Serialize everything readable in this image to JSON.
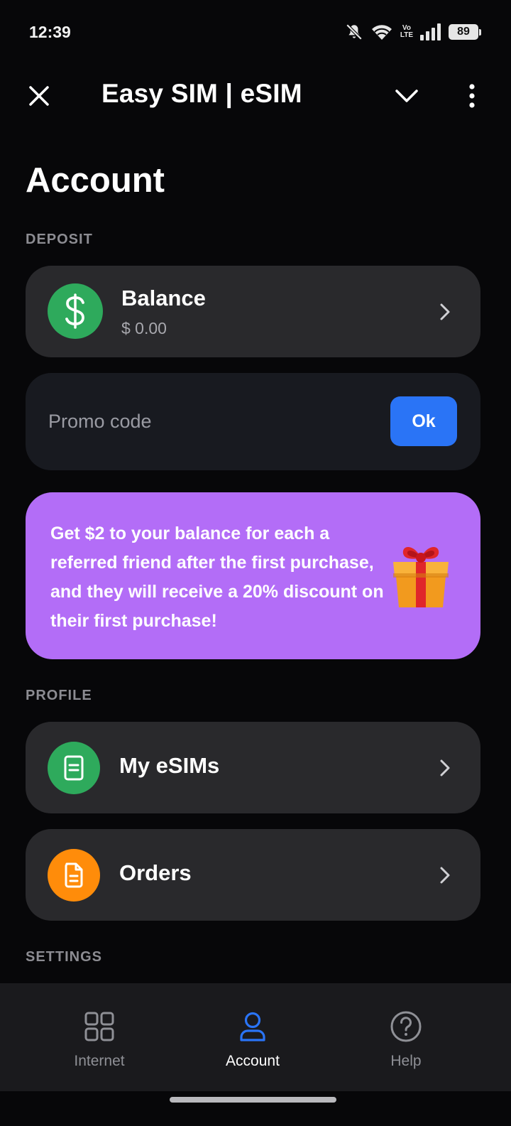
{
  "status_bar": {
    "time": "12:39",
    "battery": "89",
    "network_badge": "Vo LTE",
    "icons": [
      "bell-off-icon",
      "wifi-icon",
      "volte-icon",
      "signal-icon",
      "battery-icon"
    ]
  },
  "app_bar": {
    "title": "Easy SIM | eSIM",
    "close_icon": "close-icon",
    "chevron_icon": "chevron-down-icon",
    "menu_icon": "more-vert-icon"
  },
  "page": {
    "title": "Account"
  },
  "deposit": {
    "section_label": "DEPOSIT",
    "balance": {
      "title": "Balance",
      "amount": "$ 0.00",
      "icon": "dollar-icon",
      "icon_color": "#2eaa5c"
    },
    "promo": {
      "placeholder": "Promo code",
      "value": "",
      "button_label": "Ok",
      "button_color": "#2a74f6"
    },
    "referral": {
      "text": "Get $2 to your balance for each a referred friend after the first purchase, and they will receive a 20% discount on their first purchase!",
      "icon": "gift-icon",
      "background": "#b36df7"
    }
  },
  "profile": {
    "section_label": "PROFILE",
    "items": [
      {
        "label": "My eSIMs",
        "icon": "sim-card-icon",
        "icon_color": "#2eaa5c"
      },
      {
        "label": "Orders",
        "icon": "document-icon",
        "icon_color": "#ff8c0a"
      }
    ]
  },
  "settings": {
    "section_label": "SETTINGS"
  },
  "bottom_nav": {
    "items": [
      {
        "label": "Internet",
        "icon": "grid-icon",
        "active": false
      },
      {
        "label": "Account",
        "icon": "user-icon",
        "active": true
      },
      {
        "label": "Help",
        "icon": "help-circle-icon",
        "active": false
      }
    ],
    "active_color": "#2a74f6"
  }
}
